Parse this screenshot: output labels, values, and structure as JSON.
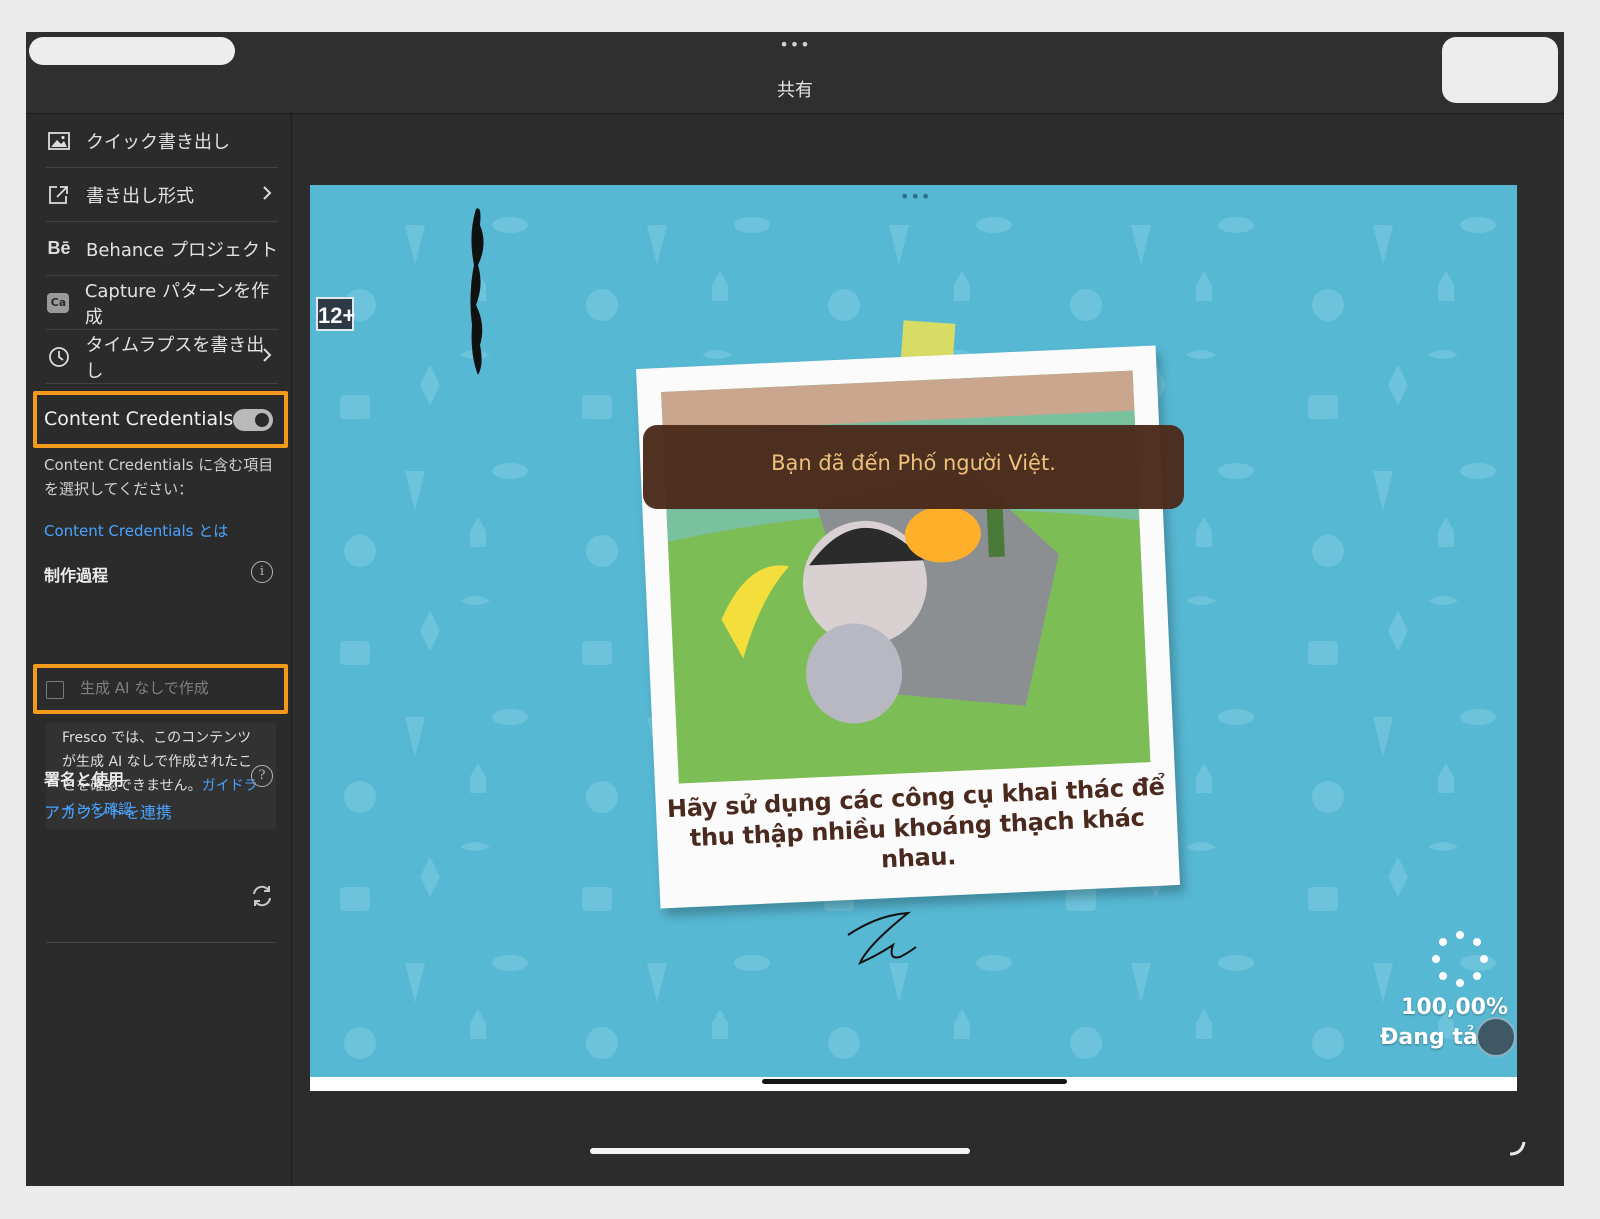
{
  "header": {
    "title": "共有",
    "more_dots": "•••"
  },
  "sidebar": {
    "items": [
      {
        "label": "クイック書き出し",
        "icon": "image-icon"
      },
      {
        "label": "書き出し形式",
        "icon": "export-icon",
        "has_chevron": true
      },
      {
        "label": "Behance プロジェクト",
        "icon": "behance-icon",
        "icon_text": "Bē"
      },
      {
        "label": "Capture パターンを作成",
        "icon": "capture-icon",
        "icon_text": "Ca"
      },
      {
        "label": "タイムラプスを書き出し",
        "icon": "clock-icon",
        "has_chevron": true
      }
    ],
    "chevron": "›",
    "content_credentials": {
      "label": "Content Credentials",
      "toggle_on": true,
      "description": "Content Credentials に含む項目を選択してください：",
      "about_link": "Content Credentials とは"
    },
    "production": {
      "title": "制作過程",
      "info_glyph": "i",
      "checkbox_label": "生成 AI なしで作成",
      "checkbox_checked": false,
      "note_text": "Fresco では、このコンテンツが生成 AI なしで作成されたことを確認できません。",
      "note_link": "ガイドラインを確認"
    },
    "signing": {
      "title": "署名と使用",
      "help_glyph": "?",
      "connect_link": "アカウントを連携"
    }
  },
  "artwork": {
    "top_dots": "•••",
    "age_rating": "12+",
    "banner": "Bạn đã đến Phố người Việt.",
    "caption_line1": "Hãy sử dụng các công cụ khai thác để",
    "caption_line2": "thu thập nhiều khoáng thạch khác nhau.",
    "progress": "100,00%",
    "status": "Đang tả"
  },
  "colors": {
    "highlight": "#f39a1d",
    "link": "#4aa3ff",
    "art_background": "#57b8d3",
    "banner_bg": "#4b2a1a",
    "banner_text": "#f2c07a"
  }
}
